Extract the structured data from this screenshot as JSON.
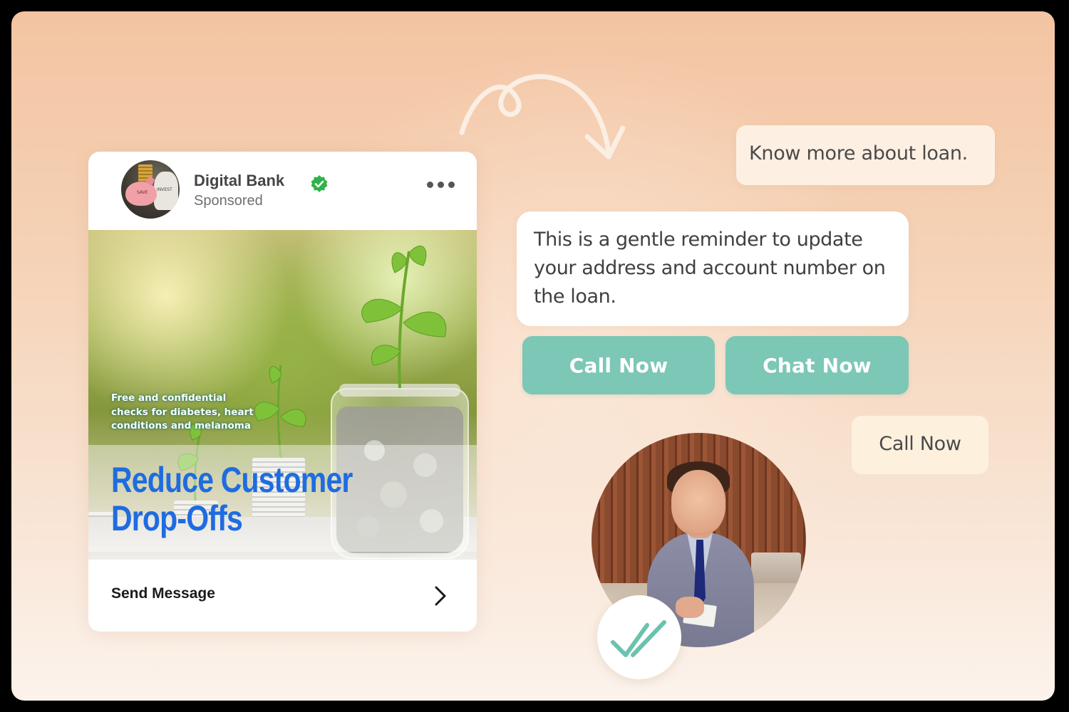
{
  "ad": {
    "brand_name": "Digital Bank",
    "sponsored_label": "Sponsored",
    "small_text": "Free and confidential checks for diabetes, heart conditions and melanoma",
    "headline_line1": "Reduce Customer",
    "headline_line2": "Drop-Offs",
    "avatar_pig_label": "SAVE",
    "avatar_sack_label": "INVEST",
    "send_message_label": "Send Message"
  },
  "chat": {
    "user_message": "Know more about loan.",
    "bot_message": "This is a gentle reminder to update your address and account number on the loan.",
    "buttons": [
      {
        "label": "Call Now"
      },
      {
        "label": "Chat Now"
      }
    ],
    "user_reply": "Call Now"
  },
  "colors": {
    "accent_teal": "#7cc7b6",
    "headline_blue": "#1f6ce0",
    "verified_green": "#2fb34a",
    "check_teal": "#6cc2ae"
  },
  "icons": {
    "verified": "verified-check-icon",
    "more": "more-dots-icon",
    "chevron": "chevron-right-icon",
    "read_receipt": "double-check-icon",
    "arrow": "curly-arrow-icon"
  }
}
